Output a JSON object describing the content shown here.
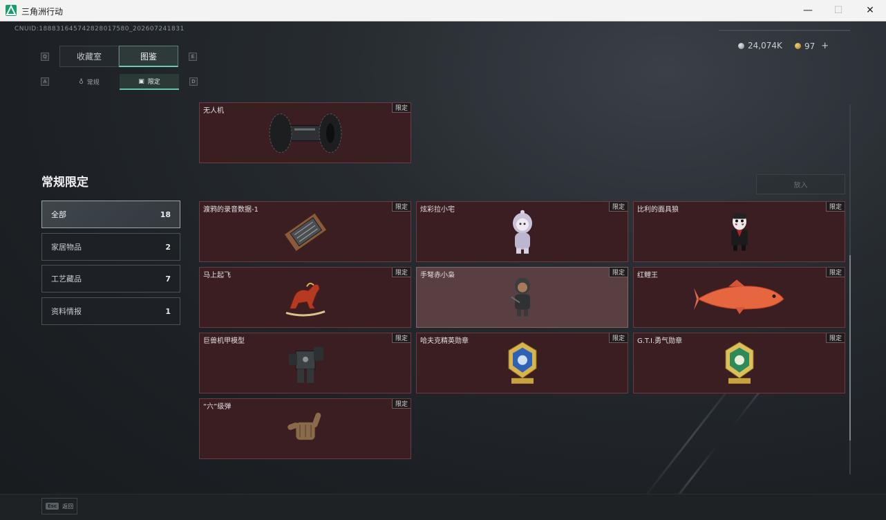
{
  "window": {
    "title": "三角洲行动",
    "min_glyph": "—",
    "max_glyph": "☐",
    "close_glyph": "✕"
  },
  "header": {
    "uid": "CNUID:188831645742828017580_202607241831",
    "currency_silver": "24,074K",
    "currency_gold": "97",
    "add_glyph": "+"
  },
  "tabs": {
    "primary": [
      {
        "label": "收藏室"
      },
      {
        "label": "图鉴"
      }
    ],
    "secondary": [
      {
        "label": "常规"
      },
      {
        "label": "限定"
      }
    ],
    "key_left_primary": "Q",
    "key_right_primary": "E",
    "key_left_secondary": "A",
    "key_right_secondary": "D"
  },
  "sidebar": {
    "title": "常规限定",
    "categories": [
      {
        "label": "全部",
        "count": "18"
      },
      {
        "label": "家居物品",
        "count": "2"
      },
      {
        "label": "工艺藏品",
        "count": "7"
      },
      {
        "label": "资料情报",
        "count": "1"
      }
    ]
  },
  "main": {
    "put_button": "放入",
    "tag": "限定",
    "cards": [
      {
        "name": "无人机",
        "icon": "drone-wheel-icon"
      },
      {
        "name": "渡鸦的录音数据-1",
        "icon": "recording-device-icon"
      },
      {
        "name": "炫彩拉小宅",
        "icon": "hooded-figure-icon"
      },
      {
        "name": "比利的面具狼",
        "icon": "puppet-doll-icon"
      },
      {
        "name": "马上起飞",
        "icon": "rocking-horse-icon"
      },
      {
        "name": "手弩赤小枭",
        "icon": "crossbow-figure-icon"
      },
      {
        "name": "红鲤王",
        "icon": "red-carp-icon"
      },
      {
        "name": "巨兽机甲模型",
        "icon": "mech-model-icon"
      },
      {
        "name": "哈夫克精英勋章",
        "icon": "blue-medal-icon"
      },
      {
        "name": "G.T.I.勇气勋章",
        "icon": "green-medal-icon"
      },
      {
        "name": "“六”级弹",
        "icon": "shaka-hand-icon"
      }
    ]
  },
  "footer": {
    "esc_key": "Esc",
    "back_label": "返回"
  }
}
